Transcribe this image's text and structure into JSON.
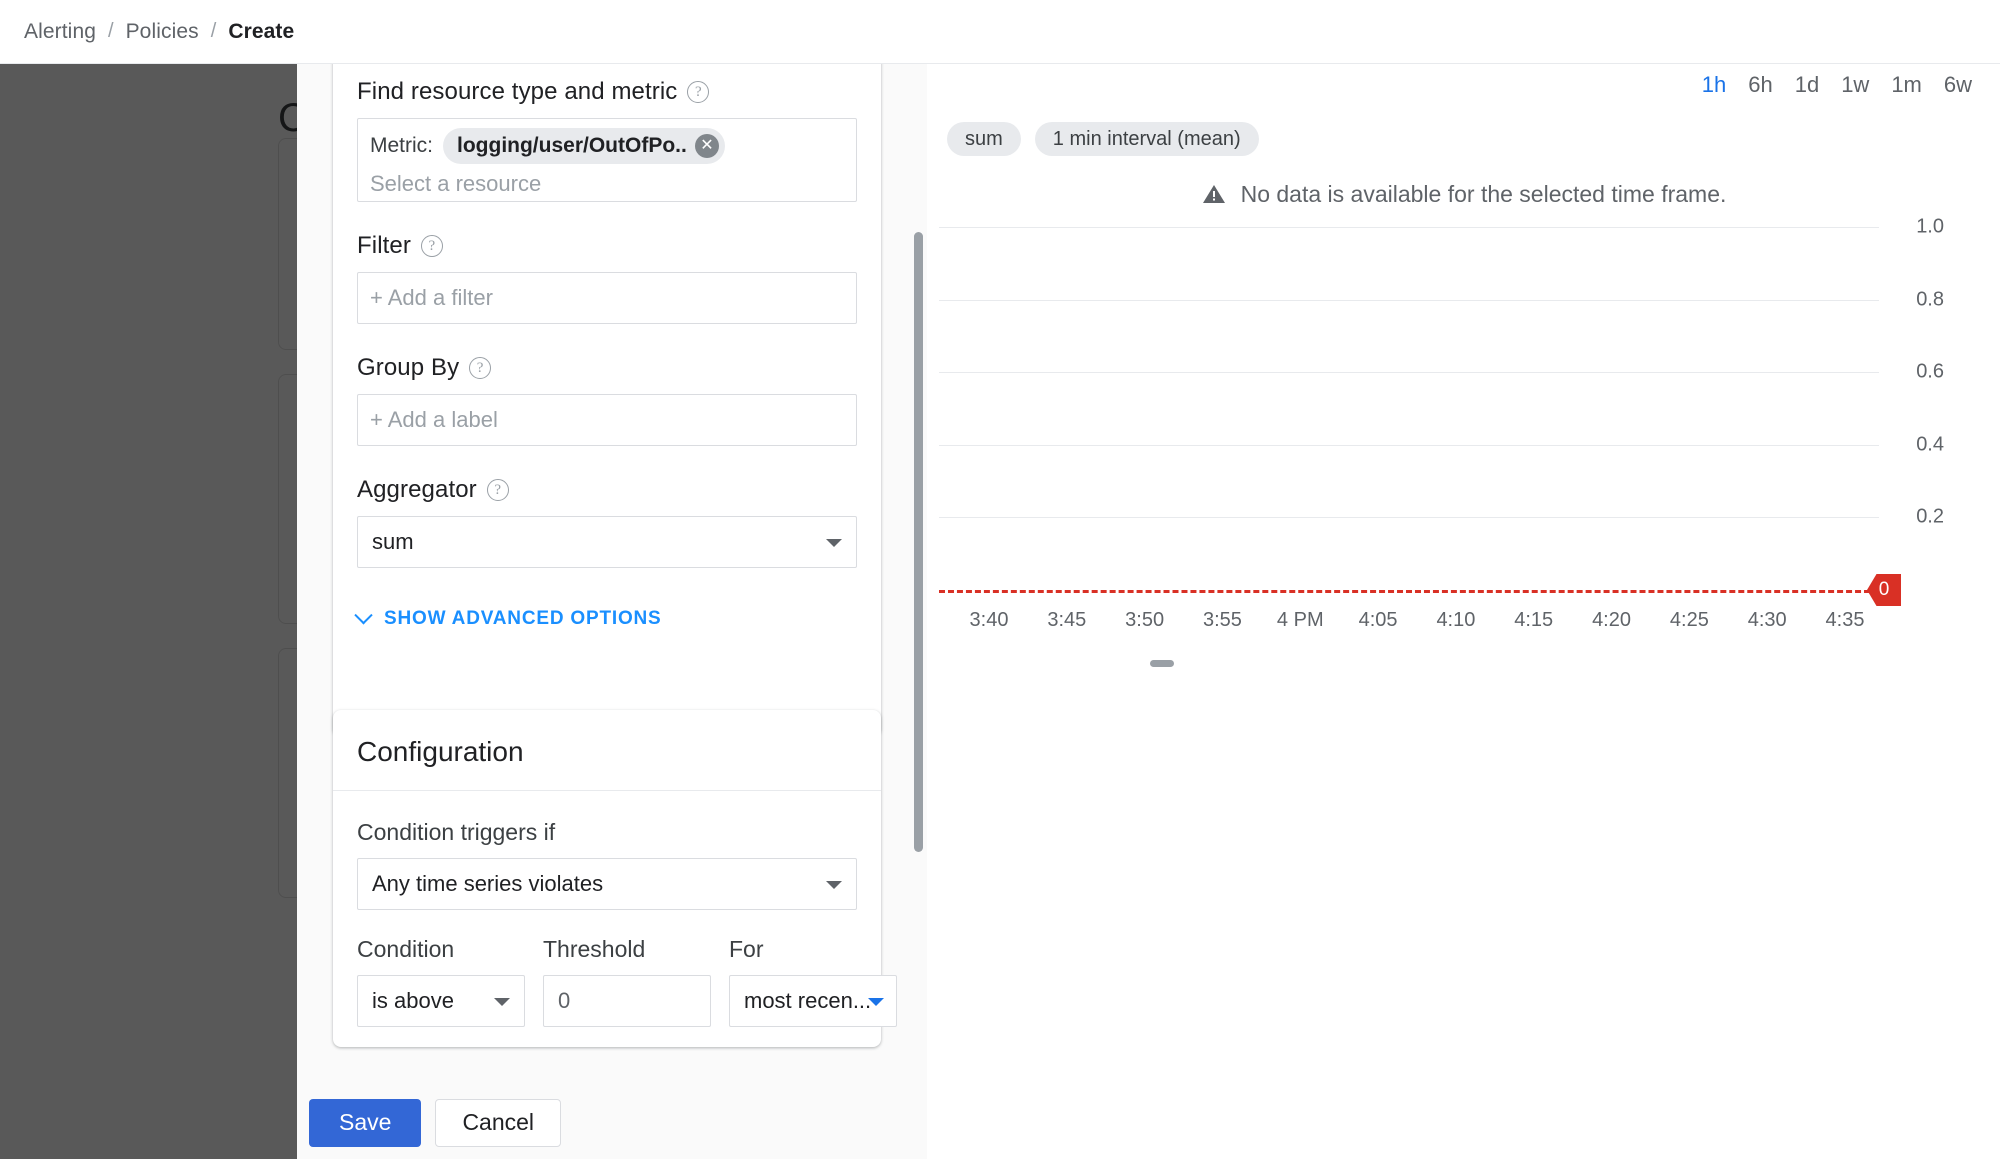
{
  "breadcrumb": {
    "items": [
      "Alerting",
      "Policies",
      "Create"
    ],
    "separator": "/"
  },
  "page_behind": {
    "title": "C"
  },
  "metric_card": {
    "find_label": "Find resource type and metric",
    "help_glyph": "?",
    "metric_key": "Metric:",
    "metric_chip": "logging/user/OutOfPo...",
    "chip_remove_glyph": "✕",
    "resource_placeholder": "Select a resource",
    "filter_label": "Filter",
    "filter_placeholder": "+ Add a filter",
    "groupby_label": "Group By",
    "groupby_placeholder": "+ Add a label",
    "aggregator_label": "Aggregator",
    "aggregator_value": "sum",
    "advanced_link": "SHOW ADVANCED OPTIONS"
  },
  "configuration": {
    "title": "Configuration",
    "trigger_label": "Condition triggers if",
    "trigger_value": "Any time series violates",
    "condition_head": "Condition",
    "condition_value": "is above",
    "threshold_head": "Threshold",
    "threshold_value": "0",
    "for_head": "For",
    "for_value": "most recen..."
  },
  "footer": {
    "save_label": "Save",
    "cancel_label": "Cancel"
  },
  "chart_panel": {
    "time_ranges": [
      "1h",
      "6h",
      "1d",
      "1w",
      "1m",
      "6w"
    ],
    "time_range_active": "1h",
    "chips": [
      "sum",
      "1 min interval (mean)"
    ],
    "no_data_message": "No data is available for the selected time frame.",
    "warning_glyph": "⚠",
    "threshold_badge": "0"
  },
  "chart_data": {
    "type": "line",
    "title": "",
    "xlabel": "",
    "ylabel": "",
    "series": [
      {
        "name": "sum",
        "values": []
      }
    ],
    "x_ticks": [
      "3:40",
      "3:45",
      "3:50",
      "3:55",
      "4 PM",
      "4:05",
      "4:10",
      "4:15",
      "4:20",
      "4:25",
      "4:30",
      "4:35"
    ],
    "y_ticks": [
      0.2,
      0.4,
      0.6,
      0.8,
      1.0
    ],
    "ylim": [
      0,
      1.05
    ],
    "grid": true,
    "legend_position": "top-left",
    "annotations": [
      {
        "type": "threshold-line",
        "value": 0,
        "color": "#d93025",
        "style": "dashed",
        "label": "0"
      }
    ],
    "empty_state": "No data is available for the selected time frame.",
    "aggregation": "sum",
    "interval": "1 min interval (mean)",
    "time_range": "1h"
  },
  "colors": {
    "accent_blue": "#1a73e8",
    "link_blue": "#1a8fff",
    "save_blue": "#3367d6",
    "threshold_red": "#d93025",
    "text_primary": "#202124",
    "text_secondary": "#5f6368",
    "border": "#dadce0"
  }
}
